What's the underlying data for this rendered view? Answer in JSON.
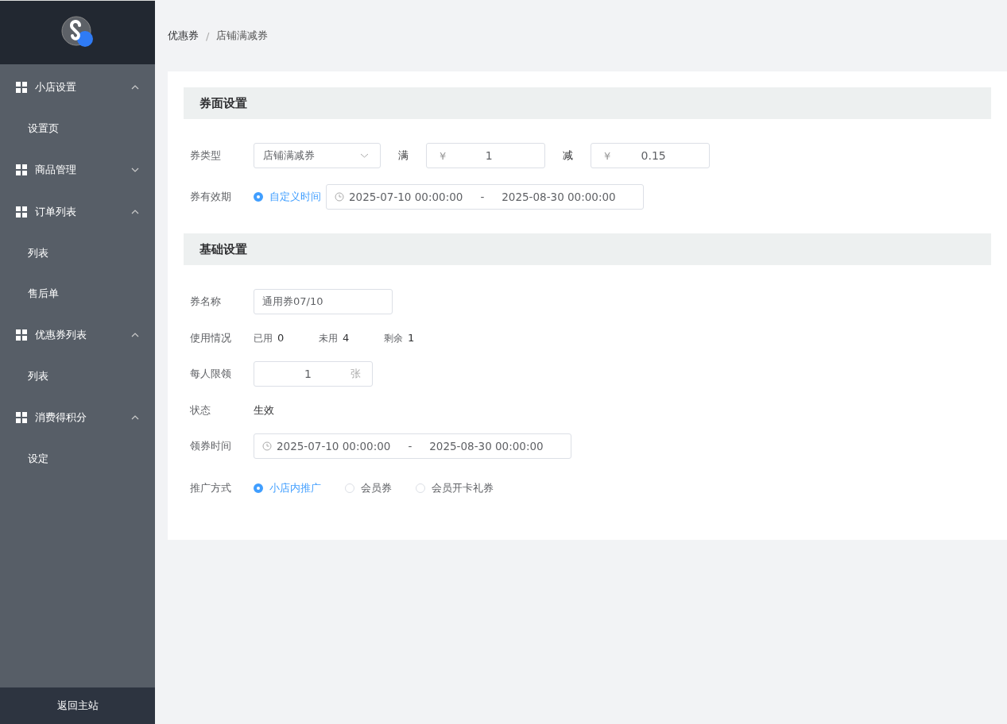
{
  "sidebar": {
    "menu": [
      {
        "label": "小店设置",
        "expanded": true,
        "children": [
          {
            "label": "设置页"
          }
        ]
      },
      {
        "label": "商品管理",
        "expanded": false
      },
      {
        "label": "订单列表",
        "expanded": true,
        "children": [
          {
            "label": "列表"
          },
          {
            "label": "售后单"
          }
        ]
      },
      {
        "label": "优惠券列表",
        "expanded": true,
        "children": [
          {
            "label": "列表"
          }
        ]
      },
      {
        "label": "消费得积分",
        "expanded": true,
        "children": [
          {
            "label": "设定"
          }
        ]
      }
    ],
    "footer_link": "返回主站"
  },
  "breadcrumb": {
    "items": [
      "优惠券",
      "店铺满减券"
    ],
    "separator": "/"
  },
  "face_section": {
    "title": "券面设置",
    "type_label": "券类型",
    "type_value": "店铺满减券",
    "full_label": "满",
    "full_currency": "¥",
    "full_value": "1",
    "minus_label": "减",
    "minus_currency": "¥",
    "minus_value": "0.15",
    "validity_label": "券有效期",
    "validity_option": {
      "label": "自定义时间",
      "selected": true
    },
    "validity_start": "2025-07-10 00:00:00",
    "validity_sep": "-",
    "validity_end": "2025-08-30 00:00:00"
  },
  "basic_section": {
    "title": "基础设置",
    "name_label": "券名称",
    "name_value": "通用券07/10",
    "usage_label": "使用情况",
    "usage": [
      {
        "label": "已用",
        "value": "0"
      },
      {
        "label": "未用",
        "value": "4"
      },
      {
        "label": "剩余",
        "value": "1"
      }
    ],
    "limit_label": "每人限领",
    "limit_value": "1",
    "limit_unit": "张",
    "status_label": "状态",
    "status_value": "生效",
    "claim_label": "领券时间",
    "claim_start": "2025-07-10 00:00:00",
    "claim_sep": "-",
    "claim_end": "2025-08-30 00:00:00",
    "promo_label": "推广方式",
    "promo_options": [
      {
        "label": "小店内推广",
        "selected": true
      },
      {
        "label": "会员券",
        "selected": false
      },
      {
        "label": "会员开卡礼券",
        "selected": false
      }
    ]
  }
}
